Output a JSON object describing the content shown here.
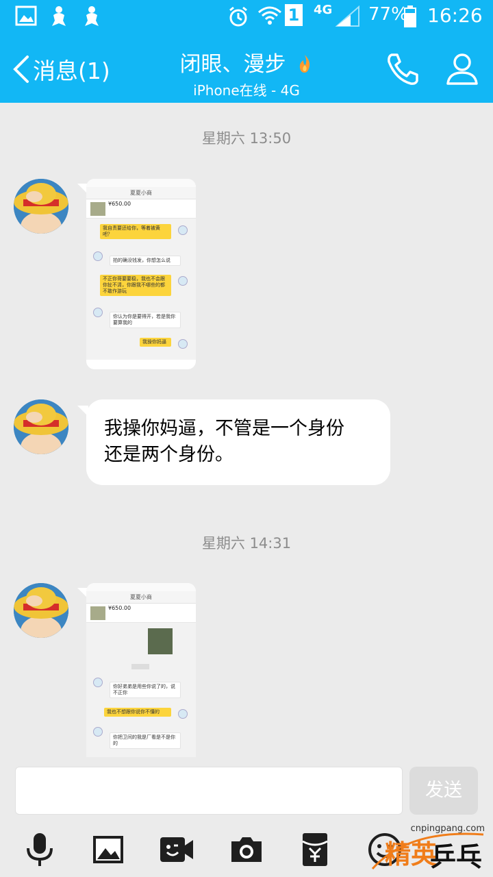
{
  "status_bar": {
    "signal_badge": "1",
    "network": "4G",
    "battery": "77%",
    "time": "16:26"
  },
  "nav": {
    "back_label": "消息(1)",
    "title": "闭眼、漫步",
    "subtitle": "iPhone在线 - 4G"
  },
  "messages": {
    "timestamp_1": "星期六 13:50",
    "timestamp_2": "星期六 14:31",
    "text_line_1": "我操你妈逼，不管是一个身份",
    "text_line_2": "还是两个身份。",
    "shot1": {
      "nav": "夏夏小商",
      "price": "¥650.00",
      "msg1": "我自责要还给你，等着被黄吧？",
      "msg2": "拍的确没钱发，你想怎么说",
      "msg3": "不正你哥要要稳，我也不会跟你扯不清，你跟我不哪些的都不敢作游玩",
      "msg4": "你认为你是要得开，若是我你要算我的",
      "msg5": "我操你妈逼"
    },
    "shot2": {
      "nav": "夏夏小商",
      "price": "¥650.00",
      "msg1": "你好弟弟是用些你说了的，说不正你",
      "msg2": "我也不想跟你说你不懂的",
      "msg3": "你把卫间的我是厂看是不是你的"
    }
  },
  "composer": {
    "send_label": "发送"
  },
  "icons": {
    "mic": "mic-icon",
    "picture": "picture-icon",
    "video": "video-icon",
    "camera": "camera-icon",
    "redpacket": "red-packet-icon",
    "emoji": "emoji-icon"
  },
  "watermark": {
    "url": "cnpingpang.com",
    "brand_a": "精英",
    "brand_b": "乒乓网"
  },
  "colors": {
    "header": "#12b7f5",
    "background": "#ebebeb"
  }
}
